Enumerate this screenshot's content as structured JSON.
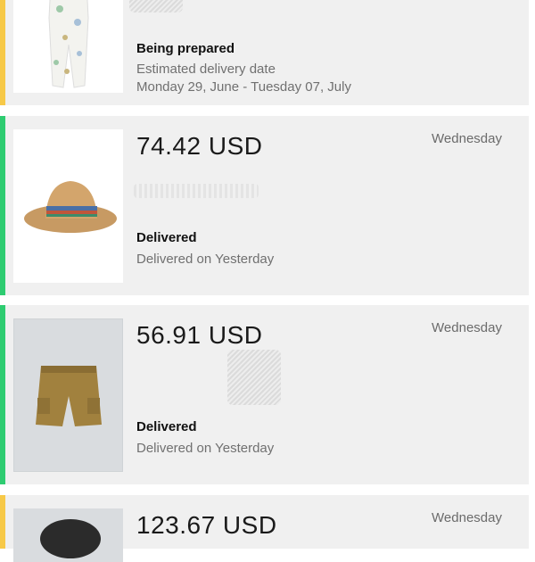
{
  "colors": {
    "prepared_stripe": "#f7c948",
    "delivered_stripe": "#2ecc71",
    "card_bg": "#f0f0f0"
  },
  "orders": [
    {
      "status": "Being prepared",
      "line1": "Estimated delivery date",
      "line2": "Monday 29, June - Tuesday 07, July"
    },
    {
      "price": "74.42 USD",
      "day": "Wednesday",
      "status": "Delivered",
      "line1": "Delivered on Yesterday"
    },
    {
      "price": "56.91 USD",
      "day": "Wednesday",
      "status": "Delivered",
      "line1": "Delivered on Yesterday"
    },
    {
      "price": "123.67 USD",
      "day": "Wednesday"
    }
  ]
}
